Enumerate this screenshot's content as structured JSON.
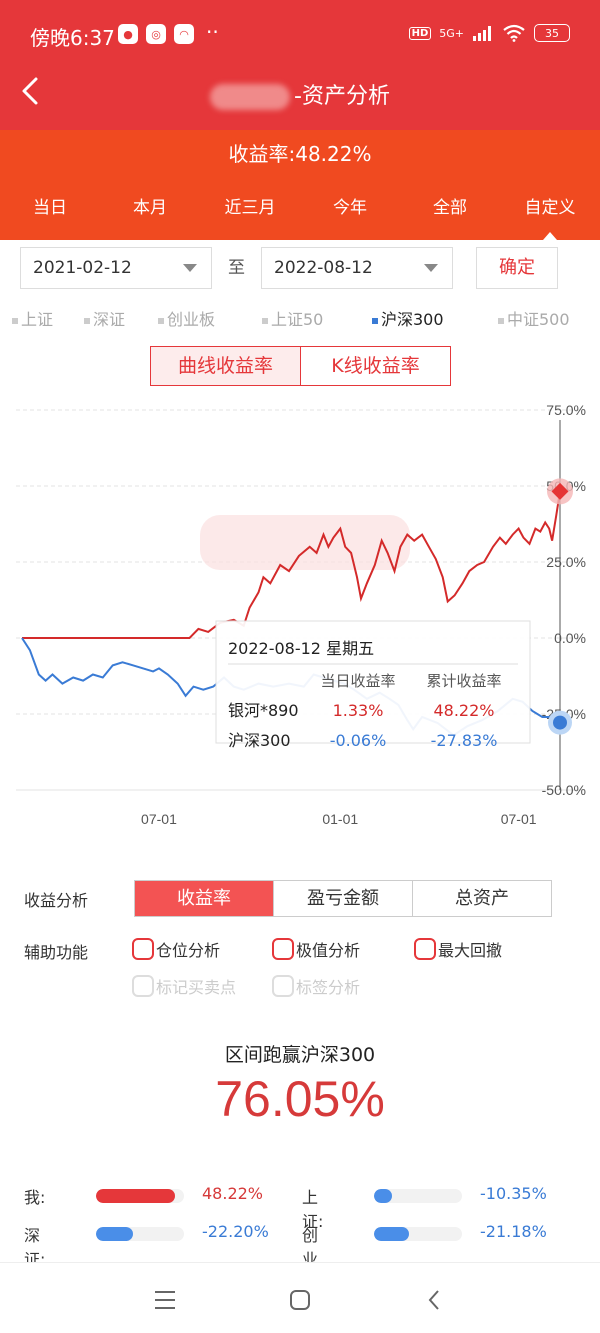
{
  "status": {
    "time": "傍晚6:37",
    "dots": "··",
    "hd": "HD",
    "network": "5G+",
    "battery": "35"
  },
  "nav": {
    "title": "-资产分析"
  },
  "summary": {
    "yield_text": "收益率:48.22%"
  },
  "tabs": [
    "当日",
    "本月",
    "近三月",
    "今年",
    "全部",
    "自定义"
  ],
  "active_tab": 5,
  "date_range": {
    "start": "2021-02-12",
    "to_label": "至",
    "end": "2022-08-12",
    "confirm": "确定"
  },
  "indices": [
    "上证",
    "深证",
    "创业板",
    "上证50",
    "沪深300",
    "中证500"
  ],
  "active_index": 4,
  "mode": {
    "curve": "曲线收益率",
    "kline": "K线收益率"
  },
  "colors": {
    "brand_red": "#e5373a",
    "header_orange": "#f04a20",
    "series_red": "#d42a2a",
    "series_blue": "#3a7bd5"
  },
  "chart_data": {
    "type": "line",
    "ylim": [
      -50,
      75
    ],
    "y_ticks": [
      "75.0%",
      "50.0%",
      "25.0%",
      "0.0%",
      "-25.0%",
      "-50.0%"
    ],
    "x_ticks": [
      "07-01",
      "01-01",
      "07-01"
    ],
    "x_tick_dates": [
      "2021-07-01",
      "2022-01-01",
      "2022-07-01"
    ],
    "start_date": "2021-02-12",
    "end_date": "2022-08-12",
    "series": [
      {
        "name": "银河*890",
        "color": "#d42a2a",
        "points": [
          [
            "2021-02-12",
            0
          ],
          [
            "2021-06-01",
            0
          ],
          [
            "2021-08-01",
            0
          ],
          [
            "2021-08-10",
            3
          ],
          [
            "2021-08-20",
            2
          ],
          [
            "2021-09-01",
            5
          ],
          [
            "2021-09-15",
            6
          ],
          [
            "2021-09-25",
            4
          ],
          [
            "2021-10-01",
            10
          ],
          [
            "2021-10-10",
            15
          ],
          [
            "2021-10-15",
            20
          ],
          [
            "2021-10-22",
            18
          ],
          [
            "2021-11-01",
            24
          ],
          [
            "2021-11-10",
            22
          ],
          [
            "2021-11-20",
            27
          ],
          [
            "2021-12-01",
            30
          ],
          [
            "2021-12-08",
            28
          ],
          [
            "2021-12-15",
            34
          ],
          [
            "2021-12-20",
            30
          ],
          [
            "2021-12-25",
            33
          ],
          [
            "2022-01-01",
            36
          ],
          [
            "2022-01-06",
            30
          ],
          [
            "2022-01-12",
            28
          ],
          [
            "2022-01-18",
            20
          ],
          [
            "2022-01-22",
            13
          ],
          [
            "2022-01-28",
            18
          ],
          [
            "2022-02-05",
            24
          ],
          [
            "2022-02-12",
            32
          ],
          [
            "2022-02-18",
            28
          ],
          [
            "2022-02-25",
            22
          ],
          [
            "2022-03-03",
            30
          ],
          [
            "2022-03-10",
            34
          ],
          [
            "2022-03-17",
            32
          ],
          [
            "2022-03-25",
            34
          ],
          [
            "2022-04-01",
            30
          ],
          [
            "2022-04-08",
            26
          ],
          [
            "2022-04-15",
            20
          ],
          [
            "2022-04-20",
            12
          ],
          [
            "2022-04-27",
            14
          ],
          [
            "2022-05-05",
            18
          ],
          [
            "2022-05-12",
            22
          ],
          [
            "2022-05-20",
            24
          ],
          [
            "2022-05-27",
            25
          ],
          [
            "2022-06-05",
            30
          ],
          [
            "2022-06-12",
            33
          ],
          [
            "2022-06-18",
            31
          ],
          [
            "2022-06-25",
            34
          ],
          [
            "2022-07-01",
            36
          ],
          [
            "2022-07-06",
            33
          ],
          [
            "2022-07-12",
            31
          ],
          [
            "2022-07-18",
            36
          ],
          [
            "2022-07-23",
            35
          ],
          [
            "2022-07-28",
            38
          ],
          [
            "2022-08-01",
            36
          ],
          [
            "2022-08-04",
            32
          ],
          [
            "2022-08-08",
            40
          ],
          [
            "2022-08-12",
            48.22
          ]
        ]
      },
      {
        "name": "沪深300",
        "color": "#3a7bd5",
        "points": [
          [
            "2021-02-12",
            0
          ],
          [
            "2021-02-20",
            -4
          ],
          [
            "2021-03-01",
            -12
          ],
          [
            "2021-03-08",
            -14
          ],
          [
            "2021-03-15",
            -12
          ],
          [
            "2021-03-25",
            -15
          ],
          [
            "2021-04-05",
            -13
          ],
          [
            "2021-04-15",
            -14
          ],
          [
            "2021-04-25",
            -12
          ],
          [
            "2021-05-05",
            -13
          ],
          [
            "2021-05-15",
            -9
          ],
          [
            "2021-05-25",
            -8
          ],
          [
            "2021-06-05",
            -9
          ],
          [
            "2021-06-15",
            -10
          ],
          [
            "2021-06-25",
            -11
          ],
          [
            "2021-07-01",
            -10
          ],
          [
            "2021-07-10",
            -12
          ],
          [
            "2021-07-20",
            -15
          ],
          [
            "2021-07-28",
            -19
          ],
          [
            "2021-08-05",
            -16
          ],
          [
            "2021-08-15",
            -17
          ],
          [
            "2021-08-25",
            -16
          ],
          [
            "2021-09-05",
            -13
          ],
          [
            "2021-09-15",
            -16
          ],
          [
            "2021-09-25",
            -17
          ],
          [
            "2021-10-10",
            -15
          ],
          [
            "2021-10-25",
            -16
          ],
          [
            "2021-11-10",
            -15
          ],
          [
            "2021-11-25",
            -16
          ],
          [
            "2021-12-05",
            -12
          ],
          [
            "2021-12-15",
            -13
          ],
          [
            "2021-12-25",
            -14
          ],
          [
            "2022-01-05",
            -15
          ],
          [
            "2022-01-15",
            -17
          ],
          [
            "2022-01-28",
            -20
          ],
          [
            "2022-02-10",
            -18
          ],
          [
            "2022-02-20",
            -20
          ],
          [
            "2022-03-01",
            -22
          ],
          [
            "2022-03-10",
            -27
          ],
          [
            "2022-03-16",
            -30
          ],
          [
            "2022-03-25",
            -26
          ],
          [
            "2022-04-10",
            -28
          ],
          [
            "2022-04-26",
            -32
          ],
          [
            "2022-05-10",
            -29
          ],
          [
            "2022-05-25",
            -27
          ],
          [
            "2022-06-10",
            -24
          ],
          [
            "2022-06-25",
            -20
          ],
          [
            "2022-07-05",
            -21
          ],
          [
            "2022-07-15",
            -24
          ],
          [
            "2022-07-25",
            -26
          ],
          [
            "2022-08-05",
            -26
          ],
          [
            "2022-08-12",
            -27.83
          ]
        ]
      }
    ],
    "tooltip": {
      "date": "2022-08-12 星期五",
      "col_daily": "当日收益率",
      "col_cum": "累计收益率",
      "rows": [
        {
          "name": "银河*890",
          "daily": "1.33%",
          "cum": "48.22%",
          "color": "#d42a2a"
        },
        {
          "name": "沪深300",
          "daily": "-0.06%",
          "cum": "-27.83%",
          "color": "#3a7bd5"
        }
      ]
    }
  },
  "analysis": {
    "label": "收益分析",
    "options": [
      "收益率",
      "盈亏金额",
      "总资产"
    ],
    "active": 0
  },
  "aux": {
    "label": "辅助功能",
    "options": [
      "仓位分析",
      "极值分析",
      "最大回撤"
    ],
    "disabled_options": [
      "标记买卖点",
      "标签分析"
    ]
  },
  "beat": {
    "label": "区间跑赢沪深300",
    "value": "76.05%"
  },
  "comparison": [
    {
      "label": "我:",
      "value": "48.22%",
      "fill": 0.9,
      "color": "#e5373a"
    },
    {
      "label": "上证:",
      "value": "-10.35%",
      "fill": 0.2,
      "color": "#4a8ee8"
    },
    {
      "label": "深证:",
      "value": "-22.20%",
      "fill": 0.42,
      "color": "#4a8ee8"
    },
    {
      "label": "创业板:",
      "value": "-21.18%",
      "fill": 0.4,
      "color": "#4a8ee8"
    }
  ]
}
